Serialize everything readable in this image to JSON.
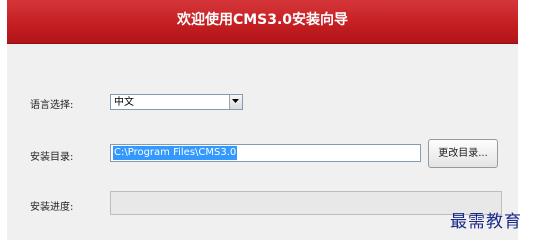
{
  "banner": {
    "title": "欢迎使用CMS3.0安装向导"
  },
  "language": {
    "label": "语言选择:",
    "selected": "中文"
  },
  "install_dir": {
    "label": "安装目录:",
    "value": "C:\\Program Files\\CMS3.0",
    "browse_label": "更改目录..."
  },
  "progress": {
    "label": "安装进度:",
    "value": 0
  },
  "watermark": {
    "text": "最需教育"
  },
  "colors": {
    "banner": "#c51f23",
    "selection": "#3399ff"
  }
}
